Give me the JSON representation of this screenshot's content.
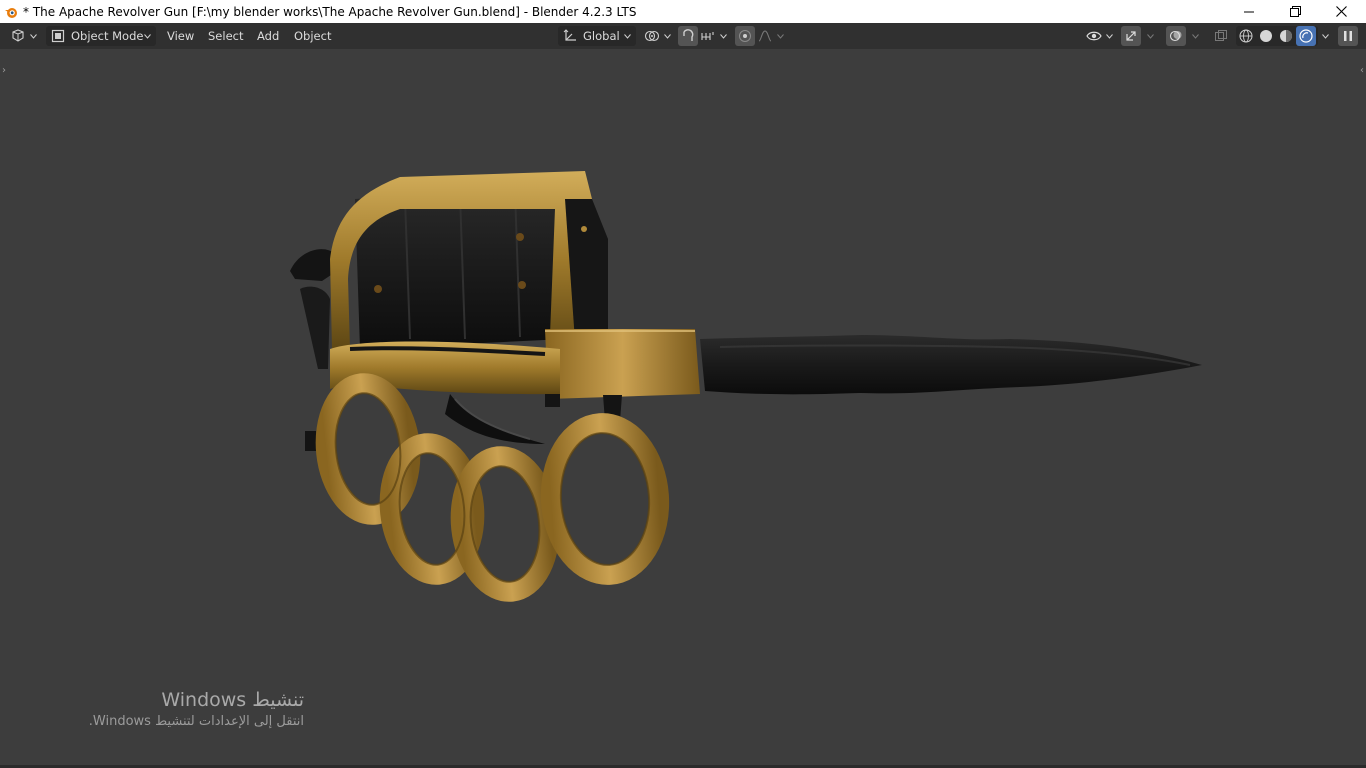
{
  "window": {
    "title": "* The Apache Revolver Gun [F:\\my blender works\\The Apache Revolver Gun.blend] - Blender 4.2.3 LTS",
    "controls": [
      "minimize-icon",
      "restore-icon",
      "close-icon"
    ]
  },
  "header": {
    "editor_type_icon": "view3d-editor-icon",
    "mode_label": "Object Mode",
    "menus": [
      "View",
      "Select",
      "Add",
      "Object"
    ],
    "orientation_label": "Global",
    "pivot_icon": "pivot-point-icon",
    "snap_icon": "snap-magnet-icon",
    "snap_increment_icon": "snap-increment-icon",
    "proportional_icon": "proportional-edit-icon",
    "falloff_icon": "falloff-curve-icon",
    "visibility_icon": "object-visibility-icon",
    "gizmo_icon": "gizmo-icon",
    "overlay_icon": "overlays-icon",
    "xray_icon": "xray-icon",
    "shading_modes": [
      "wireframe-shading-icon",
      "solid-shading-icon",
      "material-preview-icon",
      "rendered-shading-icon"
    ],
    "active_shading": "rendered-shading-icon",
    "accent_color": "#4772b3"
  },
  "viewport": {
    "background_color": "#3d3d3d",
    "object": "apache-revolver-knuckle-knife-model"
  },
  "activation_notice": {
    "title": "تنشيط Windows",
    "subtitle": "انتقل إلى الإعدادات لتنشيط Windows."
  }
}
